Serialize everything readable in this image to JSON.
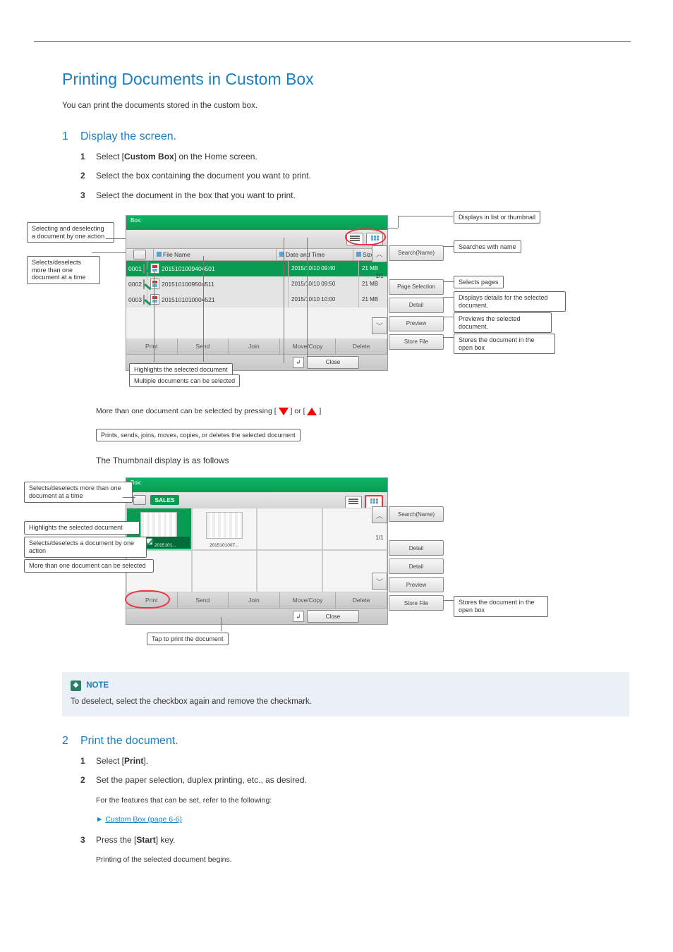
{
  "section_title": "Printing Documents in Custom Box",
  "intro_text": "You can print the documents stored in the custom box.",
  "step1": {
    "title": "Display the screen."
  },
  "step1_1_prefix": "Select [",
  "step1_1_bold": "Custom Box",
  "step1_1_suffix": "] on the Home screen.",
  "step1_2": "Select the box containing the document you want to print.",
  "step1_3": "Select the document in the box that you want to print.",
  "panel1": {
    "boxlabel": "Box:",
    "col_filename": "File Name",
    "col_datetime": "Date and Time",
    "col_size": "Size",
    "rows": [
      {
        "num": "0001",
        "name": "2015101009404501",
        "dt": "2015/10/10 09:40",
        "sz": "21 MB",
        "sel": true
      },
      {
        "num": "0002",
        "name": "2015101009504511",
        "dt": "2015/10/10 09:50",
        "sz": "21 MB",
        "sel": false
      },
      {
        "num": "0003",
        "name": "2015101010004521",
        "dt": "2015/10/10 10:00",
        "sz": "21 MB",
        "sel": false
      }
    ],
    "actions": {
      "print": "Print",
      "send": "Send",
      "join": "Join",
      "move": "Move/Copy",
      "delete": "Delete"
    },
    "side": {
      "search": "Search(Name)",
      "pagesel": "Page Selection",
      "detail": "Detail",
      "preview": "Preview",
      "store": "Store File"
    },
    "pagecount": "1/1",
    "close": "Close"
  },
  "callouts1": {
    "list_thumb": "Displays in list or thumbnail",
    "search_name": "Searches with name",
    "page_sel": "Selects pages",
    "detail_sel": "Displays details for the\nselected document.",
    "preview_sel": "Previews the selected\ndocument.",
    "store_file": "Stores the document in\nthe open box",
    "sel_desel_one": "Selecting and deselecting\na document by one action",
    "sel_desel_more": "Selects/deselects\nmore than one\ndocument at a time",
    "highlight": "Highlights the selected document",
    "multi_sel": "Multiple documents can be selected",
    "scrollnote_a": "More than one document can be selected by pressing [",
    "scrollnote_b": "] or [",
    "scrollnote_c": "]",
    "print_del": "Prints, sends, joins, moves, copies, or deletes the selected document"
  },
  "thumb_text_prefix": "The Thumbnail display is as follows",
  "panel2": {
    "boxlabel": "Box:",
    "boxname": "SALES",
    "th_names": [
      "2015101...",
      "2015101007..."
    ],
    "side": {
      "search": "Search(Name)",
      "detail1": "Detail",
      "detail2": "Detail",
      "preview": "Preview",
      "store": "Store File"
    },
    "pagecount": "1/1"
  },
  "callouts2": {
    "sel_desel": "Selects/deselects more than one\ndocument at a time",
    "highlight": "Highlights the selected document",
    "sel_one": "Selects/deselects a document by\none action",
    "more": "More than one document can be\nselected",
    "print_bold": "Tap to print the document",
    "store": "Stores the document\nin the open box"
  },
  "note": {
    "head": "NOTE",
    "bullet": "To deselect, select the checkbox again and remove the checkmark."
  },
  "step2": {
    "title": "Print the document."
  },
  "step2_1_a": "Select [",
  "step2_1_b": "Print",
  "step2_1_c": "].",
  "step2_2": "Set the paper selection, duplex printing, etc., as desired.",
  "step2_2b": "For the features that can be set, refer to the following:",
  "step2_ref_a": "Custom Box (page 6-6)",
  "step2_3_a": "Press the [",
  "step2_3_b": "Start",
  "step2_3_c": "] key.",
  "step2_3b": "Printing of the selected document begins."
}
